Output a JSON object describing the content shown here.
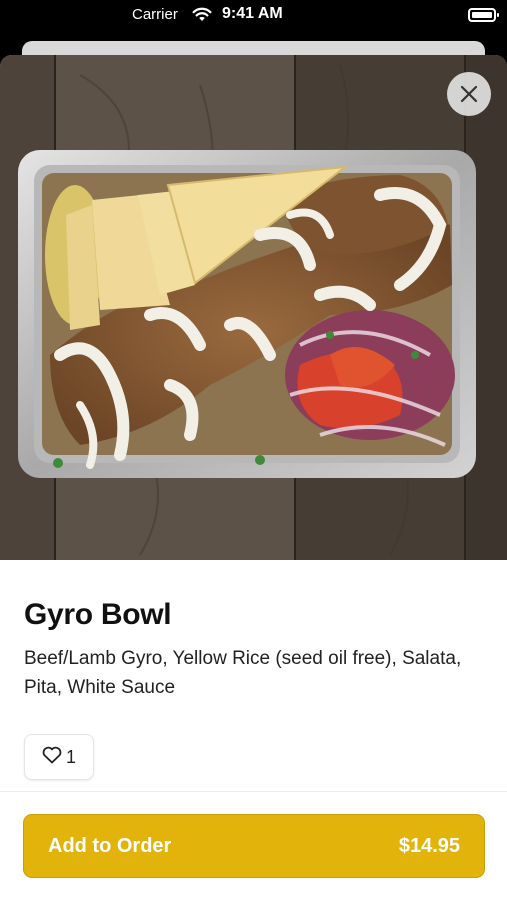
{
  "status_bar": {
    "carrier": "Carrier",
    "time": "9:41 AM"
  },
  "item": {
    "title": "Gyro Bowl",
    "description": "Beef/Lamb Gyro, Yellow Rice (seed oil free), Salata, Pita, White Sauce",
    "like_count": "1",
    "image_alt": "gyro bowl photo"
  },
  "order_button": {
    "label": "Add to Order",
    "price": "$14.95"
  },
  "colors": {
    "accent": "#e2b40b",
    "background": "#ffffff",
    "text": "#111111"
  },
  "icons": {
    "close": "close-icon",
    "like": "heart-icon",
    "wifi": "wifi-icon",
    "battery": "battery-icon"
  }
}
